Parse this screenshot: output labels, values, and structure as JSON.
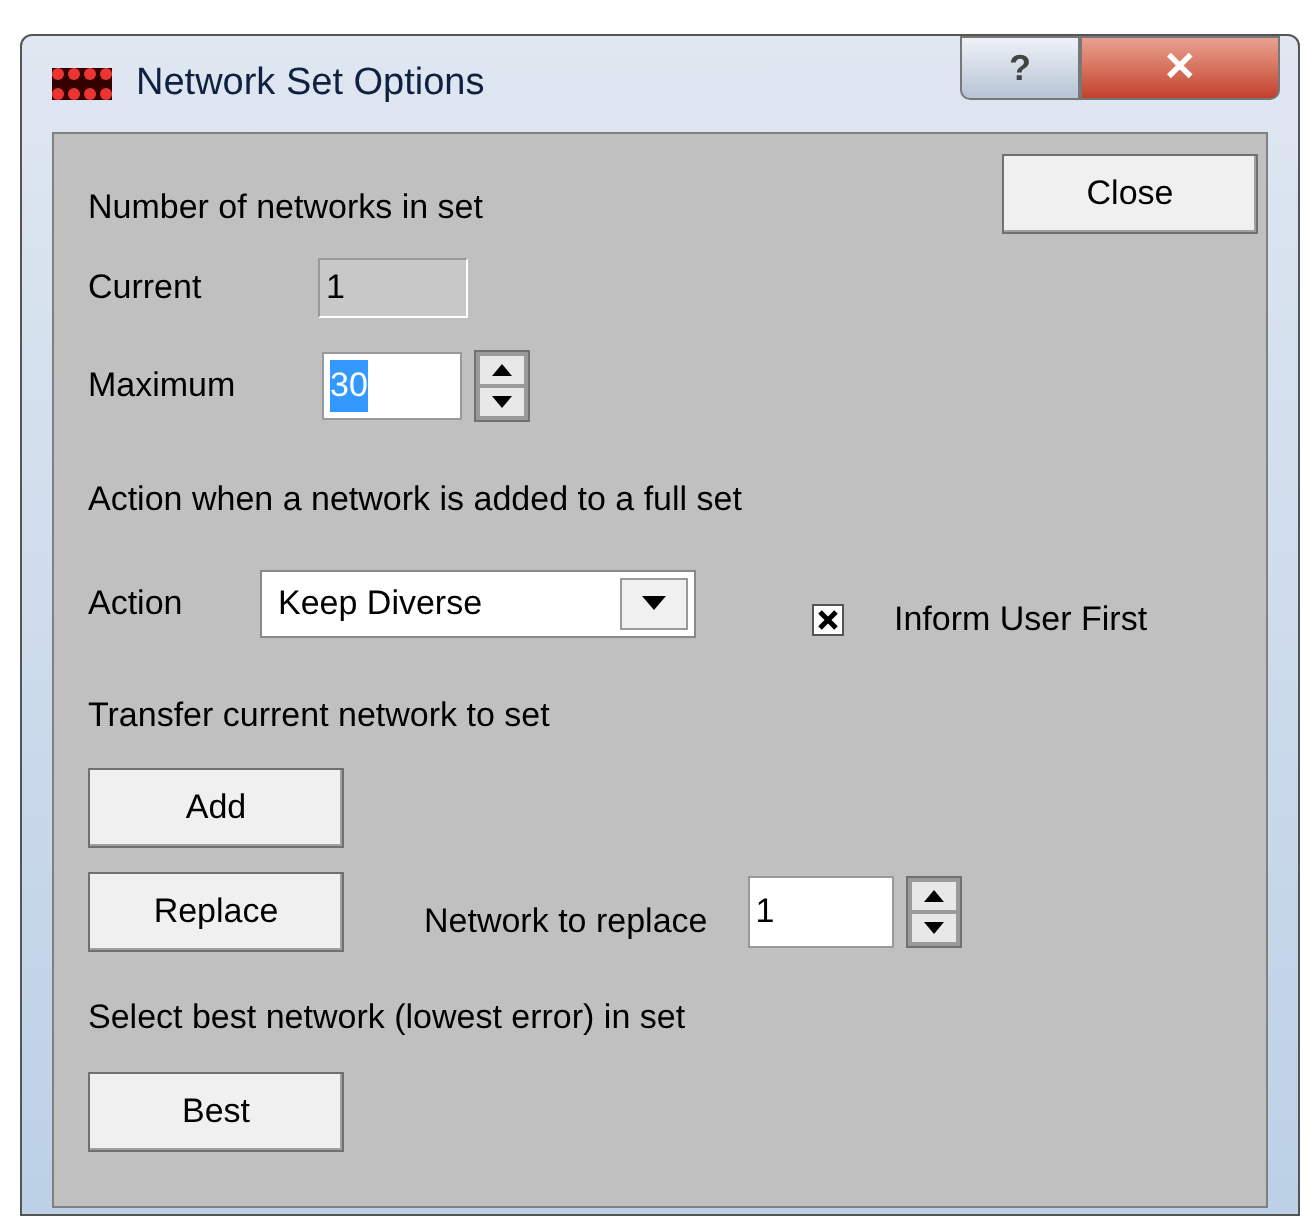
{
  "window": {
    "title": "Network Set Options",
    "help_button": "?",
    "close_button": "✕"
  },
  "count_section": {
    "heading": "Number of networks in set",
    "close_button": "Close",
    "current": {
      "label": "Current",
      "value": "1",
      "disabled": true
    },
    "maximum": {
      "label": "Maximum",
      "value": "30",
      "selected": true
    }
  },
  "action_section": {
    "heading": "Action when a network is added to a full set",
    "action": {
      "label": "Action",
      "value": "Keep Diverse"
    },
    "inform": {
      "label": "Inform User First",
      "checked": true
    }
  },
  "transfer_section": {
    "heading": "Transfer current network to set",
    "add_button": "Add",
    "replace_button": "Replace",
    "replace_field": {
      "label": "Network to replace",
      "value": "1"
    }
  },
  "best_section": {
    "heading": "Select best network (lowest error) in set",
    "best_button": "Best"
  }
}
